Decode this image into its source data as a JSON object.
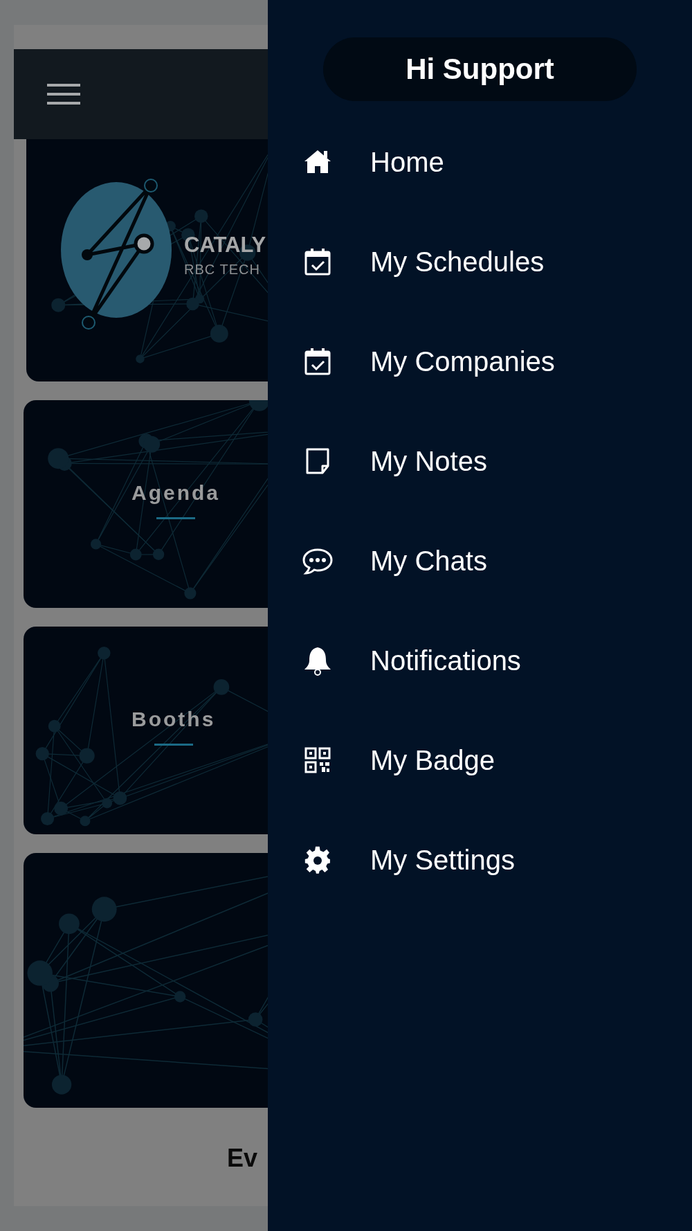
{
  "page": {
    "brand_title": "CATALY",
    "brand_subtitle": "RBC TECH",
    "cards": [
      {
        "kind": "titled",
        "title": "Agenda"
      },
      {
        "kind": "titled",
        "title": "Booths"
      },
      {
        "kind": "blank"
      }
    ],
    "footer_text": "Ev"
  },
  "drawer": {
    "greeting": "Hi Support",
    "items": [
      {
        "label": "Home"
      },
      {
        "label": "My Schedules"
      },
      {
        "label": "My Companies"
      },
      {
        "label": "My Notes"
      },
      {
        "label": "My Chats"
      },
      {
        "label": "Notifications"
      },
      {
        "label": "My Badge"
      },
      {
        "label": "My Settings"
      }
    ]
  }
}
